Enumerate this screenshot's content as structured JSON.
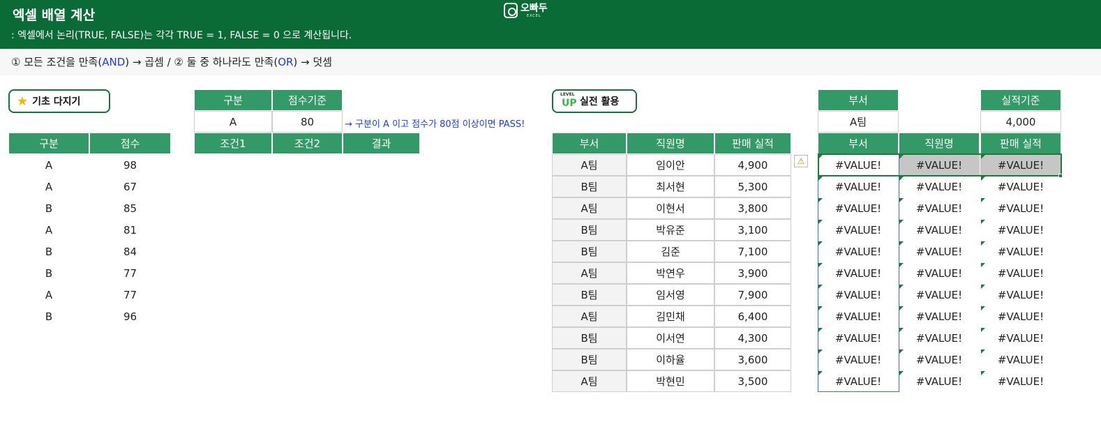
{
  "header": {
    "title": "엑셀 배열 계산",
    "subtitle": ": 엑셀에서 논리(TRUE, FALSE)는 각각 TRUE = 1, FALSE = 0 으로 계산됩니다.",
    "logo_text": "오빠두",
    "logo_sub": "EXCEL"
  },
  "rule": {
    "p1": "① 모든 조건을 만족(",
    "and": "AND",
    "p2": ") → 곱셈 / ② 둘 중 하나라도 만족(",
    "or": "OR",
    "p3": ") → 덧셈"
  },
  "badges": {
    "basic": "기초 다지기",
    "level_small": "LEVEL",
    "level_big": "UP",
    "practical": "실전 활용"
  },
  "basic_table": {
    "headers": [
      "구분",
      "점수"
    ],
    "rows": [
      [
        "A",
        "98"
      ],
      [
        "A",
        "67"
      ],
      [
        "B",
        "85"
      ],
      [
        "A",
        "81"
      ],
      [
        "B",
        "84"
      ],
      [
        "B",
        "77"
      ],
      [
        "A",
        "77"
      ],
      [
        "B",
        "96"
      ]
    ]
  },
  "criteria_table": {
    "headers": [
      "구분",
      "점수기준"
    ],
    "values": [
      "A",
      "80"
    ],
    "note": "→ 구분이 A 이고 점수가 80점 이상이면 PASS!",
    "result_headers": [
      "조건1",
      "조건2",
      "결과"
    ]
  },
  "sales_table": {
    "headers": [
      "부서",
      "직원명",
      "판매 실적"
    ],
    "rows": [
      [
        "A팀",
        "임이안",
        "4,900"
      ],
      [
        "B팀",
        "최서현",
        "5,300"
      ],
      [
        "A팀",
        "이현서",
        "3,800"
      ],
      [
        "B팀",
        "박유준",
        "3,100"
      ],
      [
        "B팀",
        "김준",
        "7,100"
      ],
      [
        "A팀",
        "박연우",
        "3,900"
      ],
      [
        "B팀",
        "임서영",
        "7,900"
      ],
      [
        "A팀",
        "김민채",
        "6,400"
      ],
      [
        "B팀",
        "이서연",
        "4,300"
      ],
      [
        "B팀",
        "이하율",
        "3,600"
      ],
      [
        "A팀",
        "박현민",
        "3,500"
      ]
    ]
  },
  "filter": {
    "dept_label": "부서",
    "dept_value": "A팀",
    "perf_label": "실적기준",
    "perf_value": "4,000",
    "result_headers": [
      "부서",
      "직원명",
      "판매 실적"
    ],
    "error_text": "#VALUE!",
    "warning_icon": "warning-triangle-icon"
  }
}
